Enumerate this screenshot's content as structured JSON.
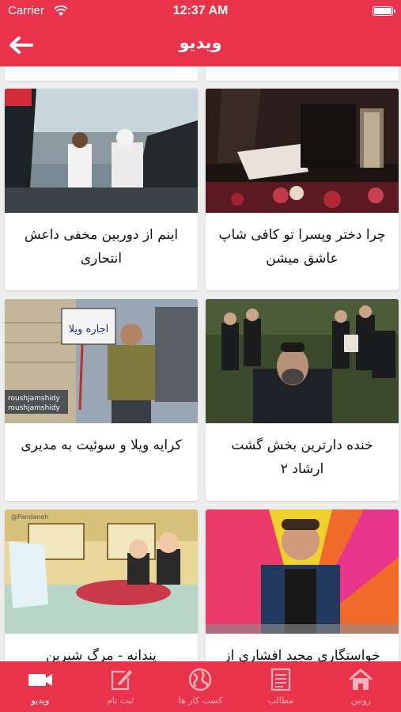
{
  "status_bar": {
    "carrier": "Carrier",
    "time": "12:37 AM"
  },
  "nav": {
    "title": "ویدیو"
  },
  "videos": [
    {
      "title": "چرا دختر وپسرا تو کافی شاپ عاشق میشن",
      "icon": "cafe-scene"
    },
    {
      "title": "اینم از دوربین مخفی داعش انتحاری",
      "icon": "car-scene"
    },
    {
      "title": "خنده دارترین بخش گشت ارشاد ۲",
      "icon": "crowd-scene"
    },
    {
      "title": "کرایه ویلا و سوئیت به مدیری",
      "icon": "villa-sign-scene"
    },
    {
      "title": "خواستگاری مجید افشاری از",
      "icon": "comedian-scene"
    },
    {
      "title": "پندانه - مرگ شیرین",
      "icon": "cartoon-scene"
    }
  ],
  "thumb_text": {
    "villa_sign": "اجاره ویلا",
    "watermark_left": "roushjamshidy",
    "watermark_cartoon": "@Pandaneh"
  },
  "tabs": [
    {
      "label": "روتین",
      "icon": "home-icon",
      "active": false
    },
    {
      "label": "مطالب",
      "icon": "articles-icon",
      "active": false
    },
    {
      "label": "کسب کار ها",
      "icon": "globe-icon",
      "active": false
    },
    {
      "label": "ثبت نام",
      "icon": "edit-icon",
      "active": false
    },
    {
      "label": "ویدیو",
      "icon": "video-camera-icon",
      "active": true
    }
  ],
  "colors": {
    "brand": "#e8334a",
    "background": "#ededed",
    "card": "#ffffff"
  }
}
